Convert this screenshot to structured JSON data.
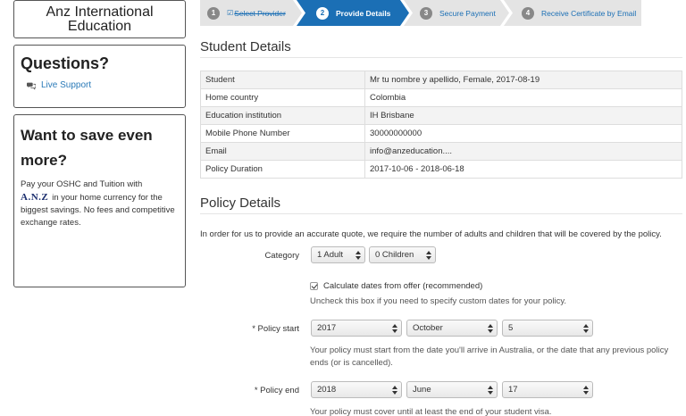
{
  "sidebar": {
    "brand_line1": "Anz International",
    "brand_line2": "Education",
    "questions_title": "Questions?",
    "live_support": "Live Support",
    "save_title_line1": "Want to save even",
    "save_title_line2": "more?",
    "save_text_1": "Pay your OSHC and Tuition with",
    "anz_logo": "A.N.Z",
    "save_text_2": "in your home currency for the biggest savings. No fees and competitive exchange rates."
  },
  "steps": [
    {
      "num": "1",
      "label": "Select Provider",
      "state": "done"
    },
    {
      "num": "2",
      "label": "Provide Details",
      "state": "active"
    },
    {
      "num": "3",
      "label": "Secure Payment",
      "state": "todo"
    },
    {
      "num": "4",
      "label": "Receive Certificate by Email",
      "state": "todo"
    }
  ],
  "student_details": {
    "title": "Student Details",
    "rows": [
      {
        "key": "Student",
        "value": "Mr tu nombre y apellido, Female, 2017-08-19"
      },
      {
        "key": "Home country",
        "value": "Colombia"
      },
      {
        "key": "Education institution",
        "value": "IH Brisbane"
      },
      {
        "key": "Mobile Phone Number",
        "value": "30000000000"
      },
      {
        "key": "Email",
        "value": "info@anzeducation...."
      },
      {
        "key": "Policy Duration",
        "value": "2017-10-06 - 2018-06-18"
      }
    ]
  },
  "policy": {
    "title": "Policy Details",
    "intro": "In order for us to provide an accurate quote, we require the number of adults and children that will be covered by the policy.",
    "category_label": "Category",
    "adults": "1 Adult",
    "children": "0 Children",
    "calc_label": "Calculate dates from offer (recommended)",
    "calc_help": "Uncheck this box if you need to specify custom dates for your policy.",
    "start_label": "* Policy start",
    "start_year": "2017",
    "start_month": "October",
    "start_day": "5",
    "start_help_1": "Your policy must start from the date you'll arrive in Australia, or the date that any previous policy",
    "start_help_2": "ends (or is cancelled).",
    "end_label": "* Policy end",
    "end_year": "2018",
    "end_month": "June",
    "end_day": "17",
    "end_help": "Your policy must cover until at least the end of your student visa."
  },
  "colors": {
    "active_step": "#1b6fb5",
    "inactive_step": "#e4e4e4",
    "link": "#2a7ab8"
  }
}
